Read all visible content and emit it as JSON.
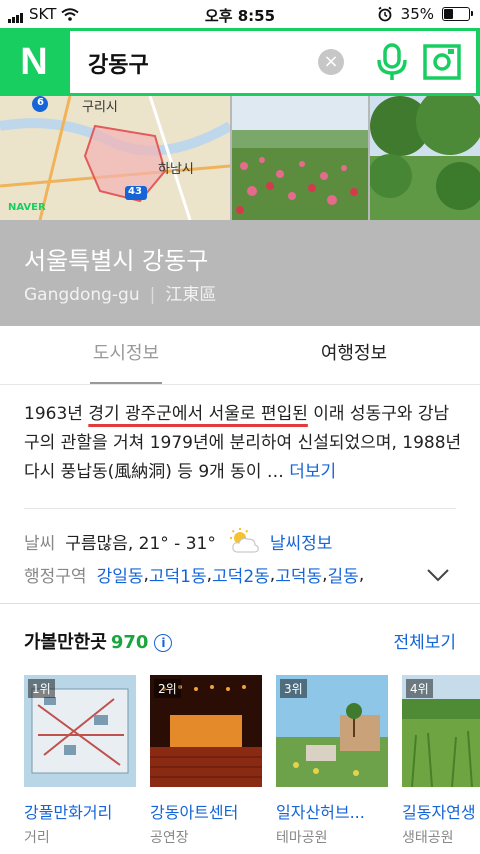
{
  "status": {
    "carrier": "SKT",
    "time": "오후 8:55",
    "battery": "35%",
    "battery_level": 0.35
  },
  "search": {
    "logo": "N",
    "query": "강동구"
  },
  "hero": {
    "title": "서울특별시 강동구",
    "romanized": "Gangdong-gu",
    "hanja": "江東區",
    "map_labels": [
      "구리시",
      "하남시",
      "NAVER",
      "43",
      "6"
    ]
  },
  "tabs": [
    "도시정보",
    "여행정보"
  ],
  "description": {
    "p1": "1963년 ",
    "hl": "경기 광주군에서 서울로 편입된",
    "p2": " 이래 성동구와 강남구의 관할을 거쳐 1979년에 분리하여 신설되었으며, 1988년 다시 풍납동(風納洞) 등 9개 동이 … ",
    "more": "더보기"
  },
  "weather": {
    "label": "날씨",
    "value": "구름많음, 21° - 31°",
    "link": "날씨정보"
  },
  "districts": {
    "label": "행정구역",
    "items": [
      "강일동",
      "고덕1동",
      "고덕2동",
      "고덕동",
      "길동"
    ],
    "sep": ", "
  },
  "places": {
    "title": "가볼만한곳",
    "count": "970",
    "view_all": "전체보기",
    "items": [
      {
        "rank": "1위",
        "name": "강풀만화거리",
        "category": "거리"
      },
      {
        "rank": "2위",
        "name": "강동아트센터",
        "category": "공연장"
      },
      {
        "rank": "3위",
        "name": "일자산허브...",
        "category": "테마공원"
      },
      {
        "rank": "4위",
        "name": "길동자연생",
        "category": "생태공원"
      }
    ]
  },
  "colors": {
    "brand": "#19ce60",
    "link": "#1565d8",
    "count": "#1aa53d",
    "underline": "#e03c3c"
  }
}
